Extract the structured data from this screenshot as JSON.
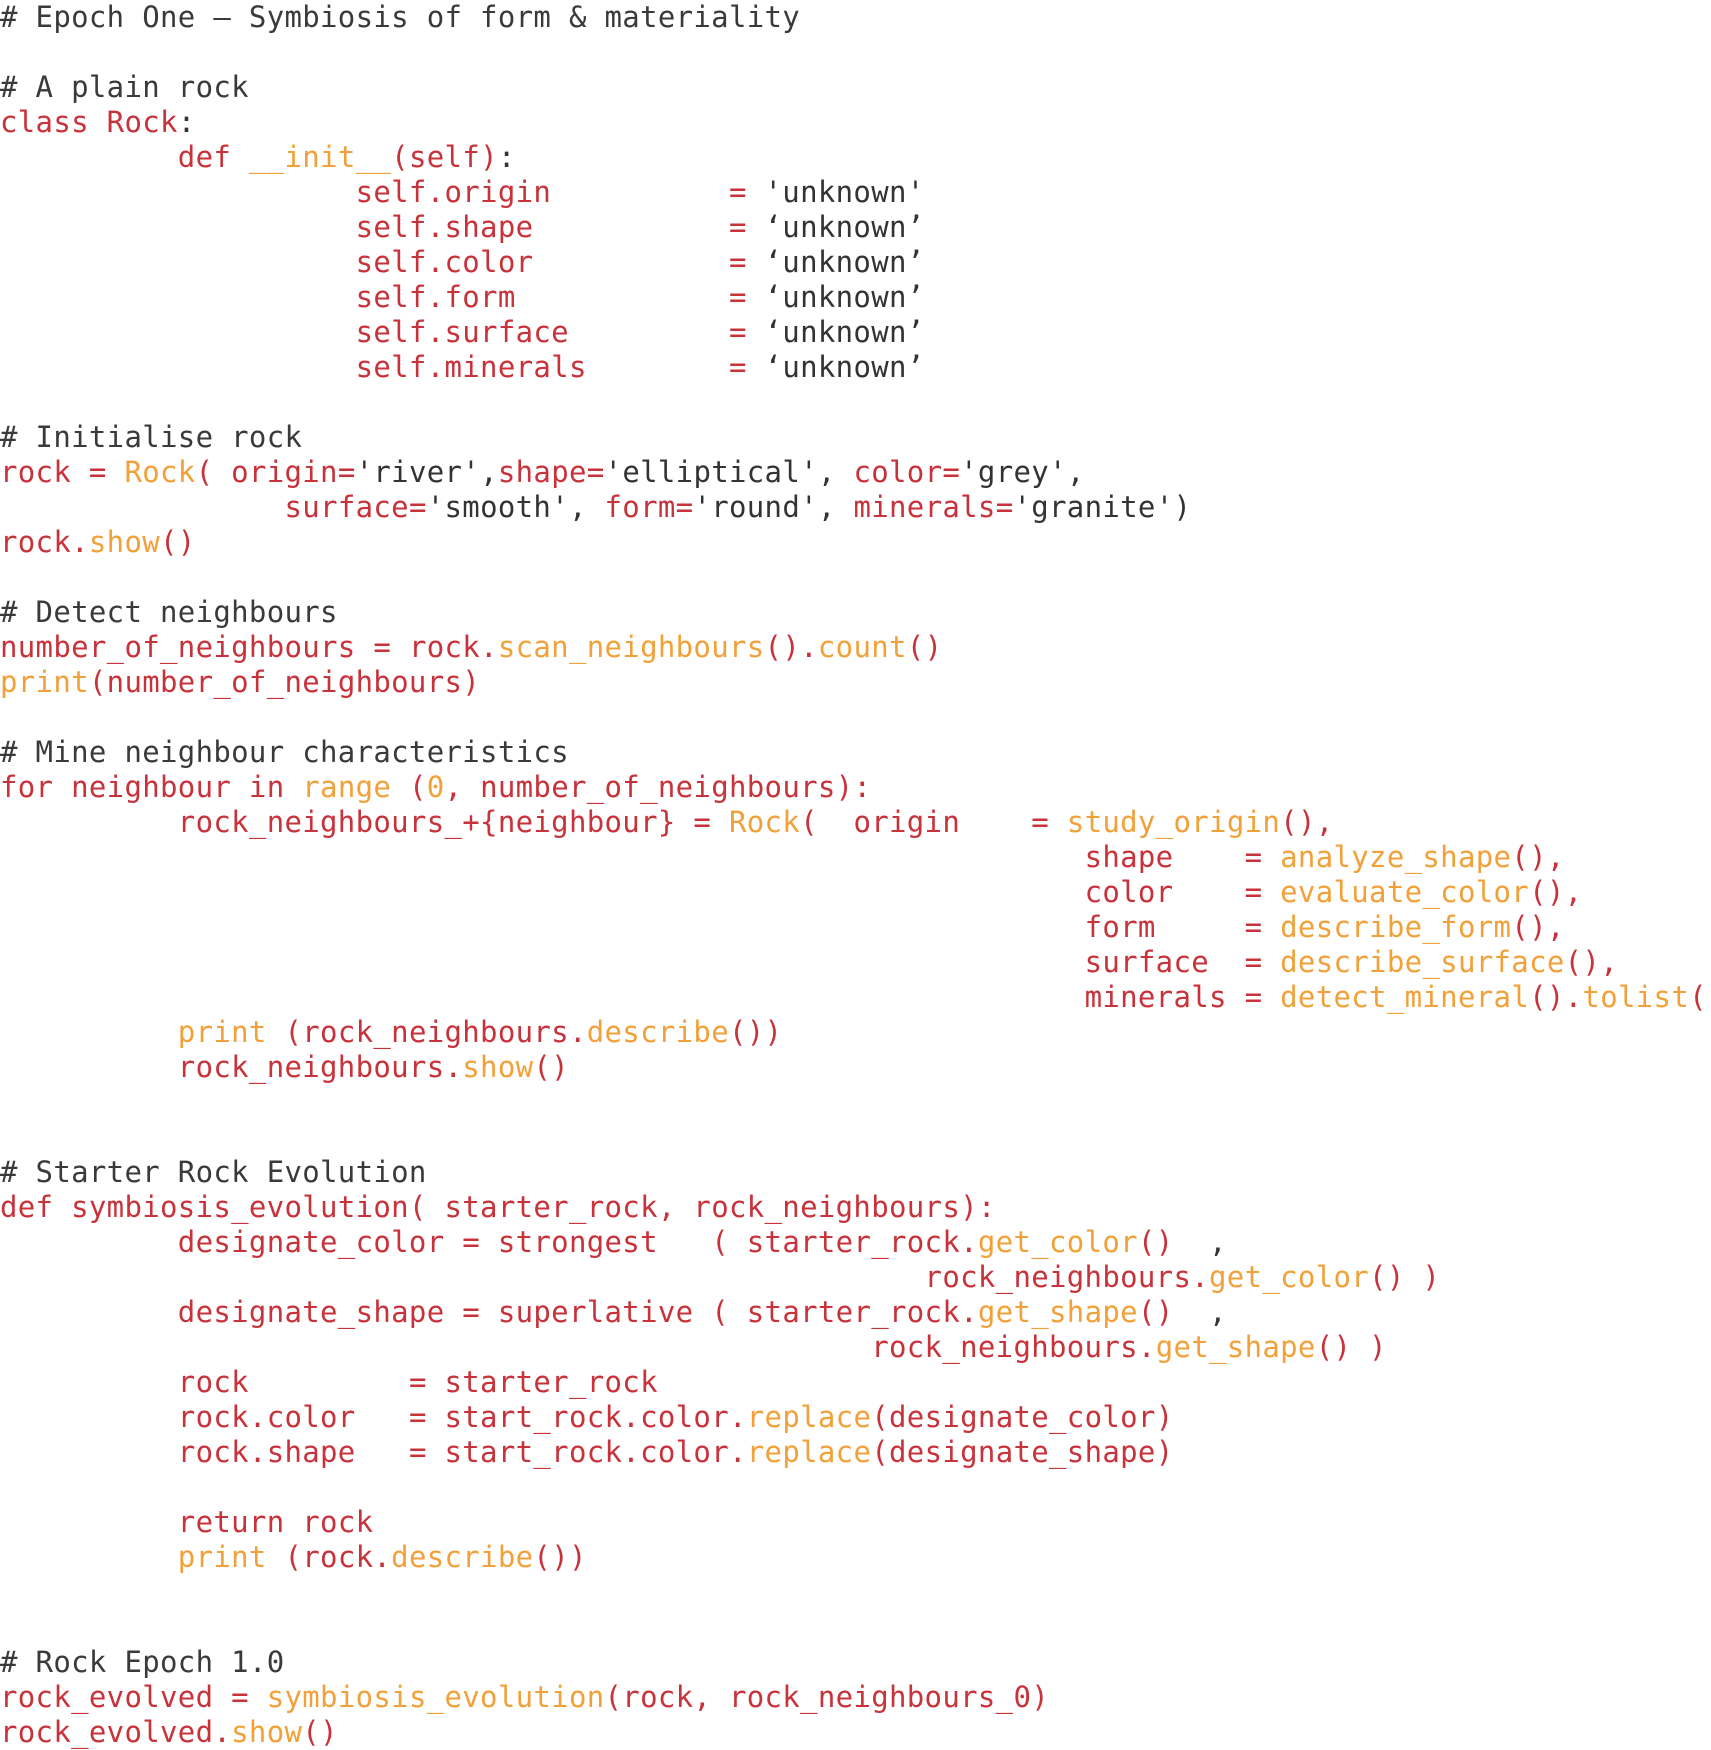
{
  "document": {
    "lines": [
      [
        [
          "c",
          "# Epoch One – Symbiosis of form & materiality"
        ]
      ],
      [],
      [
        [
          "c",
          "# A plain rock"
        ]
      ],
      [
        [
          "r",
          "class Rock"
        ],
        [
          "p",
          ":"
        ]
      ],
      [
        [
          "p",
          "          "
        ],
        [
          "r",
          "def"
        ],
        [
          "p",
          " "
        ],
        [
          "o",
          "__init__"
        ],
        [
          "r",
          "(self)"
        ],
        [
          "p",
          ":"
        ]
      ],
      [
        [
          "p",
          "                    "
        ],
        [
          "r",
          "self.origin"
        ],
        [
          "p",
          "          "
        ],
        [
          "r",
          "="
        ],
        [
          "p",
          " 'unknown'"
        ]
      ],
      [
        [
          "p",
          "                    "
        ],
        [
          "r",
          "self.shape"
        ],
        [
          "p",
          "           "
        ],
        [
          "r",
          "="
        ],
        [
          "p",
          " ‘unknown’"
        ]
      ],
      [
        [
          "p",
          "                    "
        ],
        [
          "r",
          "self.color"
        ],
        [
          "p",
          "           "
        ],
        [
          "r",
          "="
        ],
        [
          "p",
          " ‘unknown’"
        ]
      ],
      [
        [
          "p",
          "                    "
        ],
        [
          "r",
          "self.form"
        ],
        [
          "p",
          "            "
        ],
        [
          "r",
          "="
        ],
        [
          "p",
          " ‘unknown’"
        ]
      ],
      [
        [
          "p",
          "                    "
        ],
        [
          "r",
          "self.surface"
        ],
        [
          "p",
          "         "
        ],
        [
          "r",
          "="
        ],
        [
          "p",
          " ‘unknown’"
        ]
      ],
      [
        [
          "p",
          "                    "
        ],
        [
          "r",
          "self.minerals"
        ],
        [
          "p",
          "        "
        ],
        [
          "r",
          "="
        ],
        [
          "p",
          " ‘unknown’"
        ]
      ],
      [],
      [
        [
          "c",
          "# Initialise rock"
        ]
      ],
      [
        [
          "r",
          "rock"
        ],
        [
          "p",
          " "
        ],
        [
          "r",
          "="
        ],
        [
          "p",
          " "
        ],
        [
          "o",
          "Rock"
        ],
        [
          "r",
          "( origin="
        ],
        [
          "p",
          "'river',"
        ],
        [
          "r",
          "shape="
        ],
        [
          "p",
          "'elliptical', "
        ],
        [
          "r",
          "color="
        ],
        [
          "p",
          "'grey',"
        ]
      ],
      [
        [
          "p",
          "                "
        ],
        [
          "r",
          "surface="
        ],
        [
          "p",
          "'smooth', "
        ],
        [
          "r",
          "form="
        ],
        [
          "p",
          "'round', "
        ],
        [
          "r",
          "minerals="
        ],
        [
          "p",
          "'granite')"
        ]
      ],
      [
        [
          "r",
          "rock."
        ],
        [
          "o",
          "show"
        ],
        [
          "r",
          "()"
        ]
      ],
      [],
      [
        [
          "c",
          "# Detect neighbours"
        ]
      ],
      [
        [
          "r",
          "number_of_neighbours"
        ],
        [
          "p",
          " "
        ],
        [
          "r",
          "="
        ],
        [
          "p",
          " "
        ],
        [
          "r",
          "rock."
        ],
        [
          "o",
          "scan_neighbours"
        ],
        [
          "r",
          "()."
        ],
        [
          "o",
          "count"
        ],
        [
          "r",
          "()"
        ]
      ],
      [
        [
          "o",
          "print"
        ],
        [
          "r",
          "(number_of_neighbours)"
        ]
      ],
      [],
      [
        [
          "c",
          "# Mine neighbour characteristics"
        ]
      ],
      [
        [
          "r",
          "for"
        ],
        [
          "p",
          " "
        ],
        [
          "r",
          "neighbour"
        ],
        [
          "p",
          " "
        ],
        [
          "r",
          "in"
        ],
        [
          "p",
          " "
        ],
        [
          "o",
          "range"
        ],
        [
          "p",
          " "
        ],
        [
          "r",
          "("
        ],
        [
          "o",
          "0"
        ],
        [
          "r",
          ", number_of_neighbours):"
        ]
      ],
      [
        [
          "p",
          "          "
        ],
        [
          "r",
          "rock_neighbours_+{neighbour}"
        ],
        [
          "p",
          " "
        ],
        [
          "r",
          "="
        ],
        [
          "p",
          " "
        ],
        [
          "o",
          "Rock"
        ],
        [
          "r",
          "("
        ],
        [
          "p",
          "  "
        ],
        [
          "r",
          "origin"
        ],
        [
          "p",
          "    "
        ],
        [
          "r",
          "="
        ],
        [
          "p",
          " "
        ],
        [
          "o",
          "study_origin"
        ],
        [
          "r",
          "(),"
        ]
      ],
      [
        [
          "p",
          "                                                             "
        ],
        [
          "r",
          "shape"
        ],
        [
          "p",
          "    "
        ],
        [
          "r",
          "="
        ],
        [
          "p",
          " "
        ],
        [
          "o",
          "analyze_shape"
        ],
        [
          "r",
          "(),"
        ]
      ],
      [
        [
          "p",
          "                                                             "
        ],
        [
          "r",
          "color"
        ],
        [
          "p",
          "    "
        ],
        [
          "r",
          "="
        ],
        [
          "p",
          " "
        ],
        [
          "o",
          "evaluate_color"
        ],
        [
          "r",
          "(),"
        ]
      ],
      [
        [
          "p",
          "                                                             "
        ],
        [
          "r",
          "form"
        ],
        [
          "p",
          "     "
        ],
        [
          "r",
          "="
        ],
        [
          "p",
          " "
        ],
        [
          "o",
          "describe_form"
        ],
        [
          "r",
          "(),"
        ]
      ],
      [
        [
          "p",
          "                                                             "
        ],
        [
          "r",
          "surface"
        ],
        [
          "p",
          "  "
        ],
        [
          "r",
          "="
        ],
        [
          "p",
          " "
        ],
        [
          "o",
          "describe_surface"
        ],
        [
          "r",
          "(),"
        ]
      ],
      [
        [
          "p",
          "                                                             "
        ],
        [
          "r",
          "minerals"
        ],
        [
          "p",
          " "
        ],
        [
          "r",
          "="
        ],
        [
          "p",
          " "
        ],
        [
          "o",
          "detect_mineral"
        ],
        [
          "r",
          "()."
        ],
        [
          "o",
          "tolist"
        ],
        [
          "r",
          "())"
        ]
      ],
      [
        [
          "p",
          "          "
        ],
        [
          "o",
          "print"
        ],
        [
          "p",
          " "
        ],
        [
          "r",
          "(rock_neighbours."
        ],
        [
          "o",
          "describe"
        ],
        [
          "r",
          "())"
        ]
      ],
      [
        [
          "p",
          "          "
        ],
        [
          "r",
          "rock_neighbours."
        ],
        [
          "o",
          "show"
        ],
        [
          "r",
          "()"
        ]
      ],
      [],
      [],
      [
        [
          "c",
          "# Starter Rock Evolution"
        ]
      ],
      [
        [
          "r",
          "def"
        ],
        [
          "p",
          " "
        ],
        [
          "r",
          "symbiosis_evolution("
        ],
        [
          "p",
          " "
        ],
        [
          "r",
          "starter_rock, rock_neighbours):"
        ]
      ],
      [
        [
          "p",
          "          "
        ],
        [
          "r",
          "designate_color"
        ],
        [
          "p",
          " "
        ],
        [
          "r",
          "="
        ],
        [
          "p",
          " "
        ],
        [
          "r",
          "strongest"
        ],
        [
          "p",
          "   "
        ],
        [
          "r",
          "( starter_rock."
        ],
        [
          "o",
          "get_color"
        ],
        [
          "r",
          "()"
        ],
        [
          "p",
          "  ,"
        ]
      ],
      [
        [
          "p",
          "                                                    "
        ],
        [
          "r",
          "rock_neighbours."
        ],
        [
          "o",
          "get_color"
        ],
        [
          "r",
          "()"
        ],
        [
          "p",
          " "
        ],
        [
          "r",
          ")"
        ]
      ],
      [
        [
          "p",
          "          "
        ],
        [
          "r",
          "designate_shape"
        ],
        [
          "p",
          " "
        ],
        [
          "r",
          "="
        ],
        [
          "p",
          " "
        ],
        [
          "r",
          "superlative"
        ],
        [
          "p",
          " "
        ],
        [
          "r",
          "( starter_rock."
        ],
        [
          "o",
          "get_shape"
        ],
        [
          "r",
          "()"
        ],
        [
          "p",
          "  ,"
        ]
      ],
      [
        [
          "p",
          "                                                 "
        ],
        [
          "r",
          "rock_neighbours."
        ],
        [
          "o",
          "get_shape"
        ],
        [
          "r",
          "()"
        ],
        [
          "p",
          " "
        ],
        [
          "r",
          ")"
        ]
      ],
      [
        [
          "p",
          "          "
        ],
        [
          "r",
          "rock"
        ],
        [
          "p",
          "         "
        ],
        [
          "r",
          "="
        ],
        [
          "p",
          " "
        ],
        [
          "r",
          "starter_rock"
        ]
      ],
      [
        [
          "p",
          "          "
        ],
        [
          "r",
          "rock.color"
        ],
        [
          "p",
          "   "
        ],
        [
          "r",
          "="
        ],
        [
          "p",
          " "
        ],
        [
          "r",
          "start_rock.color."
        ],
        [
          "o",
          "replace"
        ],
        [
          "r",
          "(designate_color)"
        ]
      ],
      [
        [
          "p",
          "          "
        ],
        [
          "r",
          "rock.shape"
        ],
        [
          "p",
          "   "
        ],
        [
          "r",
          "="
        ],
        [
          "p",
          " "
        ],
        [
          "r",
          "start_rock.color."
        ],
        [
          "o",
          "replace"
        ],
        [
          "r",
          "(designate_shape)"
        ]
      ],
      [],
      [
        [
          "p",
          "          "
        ],
        [
          "r",
          "return"
        ],
        [
          "p",
          " "
        ],
        [
          "r",
          "rock"
        ]
      ],
      [
        [
          "p",
          "          "
        ],
        [
          "o",
          "print"
        ],
        [
          "p",
          " "
        ],
        [
          "r",
          "(rock."
        ],
        [
          "o",
          "describe"
        ],
        [
          "r",
          "())"
        ]
      ],
      [],
      [],
      [
        [
          "c",
          "# Rock Epoch 1.0"
        ]
      ],
      [
        [
          "r",
          "rock_evolved"
        ],
        [
          "p",
          " "
        ],
        [
          "r",
          "="
        ],
        [
          "p",
          " "
        ],
        [
          "o",
          "symbiosis_evolution"
        ],
        [
          "r",
          "(rock, rock_neighbours_0)"
        ]
      ],
      [
        [
          "r",
          "rock_evolved."
        ],
        [
          "o",
          "show"
        ],
        [
          "r",
          "()"
        ]
      ]
    ]
  },
  "colors": {
    "comment": "#3a3a3a",
    "plain": "#333333",
    "keyword_identifier": "#c8323a",
    "function_call": "#f2a13a",
    "background": "#ffffff"
  }
}
